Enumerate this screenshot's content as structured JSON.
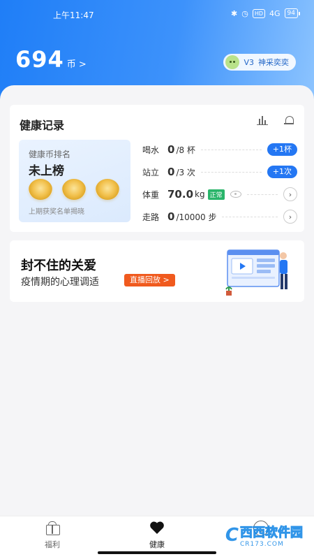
{
  "status_bar": {
    "time": "上午11:47",
    "hd": "HD",
    "signal": "4G",
    "battery": "94"
  },
  "header": {
    "coins": "694",
    "coins_unit": "币",
    "coins_arrow": ">",
    "level": "V3",
    "username": "神采奕奕"
  },
  "health_card": {
    "title": "健康记录",
    "ranking": {
      "label": "健康币排名",
      "status": "未上榜",
      "footnote": "上期获奖名单揭晓"
    },
    "records": [
      {
        "label": "喝水",
        "value": "0",
        "unit": "/8 杯",
        "action": "+1杯"
      },
      {
        "label": "站立",
        "value": "0",
        "unit": "/3 次",
        "action": "+1次"
      },
      {
        "label": "体重",
        "value": "70.0",
        "unit": "kg",
        "badge": "正常"
      },
      {
        "label": "走路",
        "value": "0",
        "unit": "/10000 步"
      }
    ]
  },
  "promo": {
    "title": "封不住的关爱",
    "subtitle": "疫情期的心理调适",
    "button": "直播回放 >"
  },
  "tabbar": {
    "tabs": [
      {
        "label": "福利",
        "icon": "gift-icon"
      },
      {
        "label": "健康",
        "icon": "heart-icon",
        "active": true
      },
      {
        "label": "",
        "icon": "smile-icon"
      }
    ]
  },
  "watermark": {
    "brand": "西西软件园",
    "url": "CR173.COM"
  },
  "colors": {
    "primary": "#2477f3",
    "accent": "#f05a1e",
    "good": "#29b56a"
  }
}
